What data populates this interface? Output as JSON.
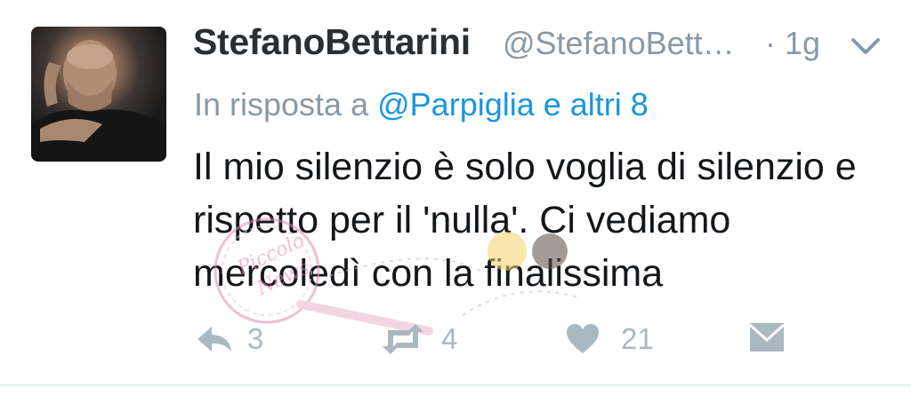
{
  "tweet": {
    "display_name": "StefanoBettarini",
    "handle": "@StefanoBett…",
    "time": "· 1g",
    "reply_prefix": "In risposta a",
    "reply_targets": "@Parpiglia e altri 8",
    "text": "Il mio silenzio è solo voglia di silenzio e rispetto per il 'nulla'. Ci vediamo mercoledì con la finalissima",
    "watermark_text": "Piccolo News"
  },
  "actions": {
    "replies": "3",
    "retweets": "4",
    "likes": "21"
  },
  "icons": {
    "reply": "reply-icon",
    "retweet": "retweet-icon",
    "like": "heart-icon",
    "dm": "envelope-icon",
    "caret": "chevron-down-icon"
  },
  "colors": {
    "name": "#292f33",
    "secondary": "#8899a6",
    "link": "#1b95e0",
    "action_icon": "#aab8c2"
  }
}
